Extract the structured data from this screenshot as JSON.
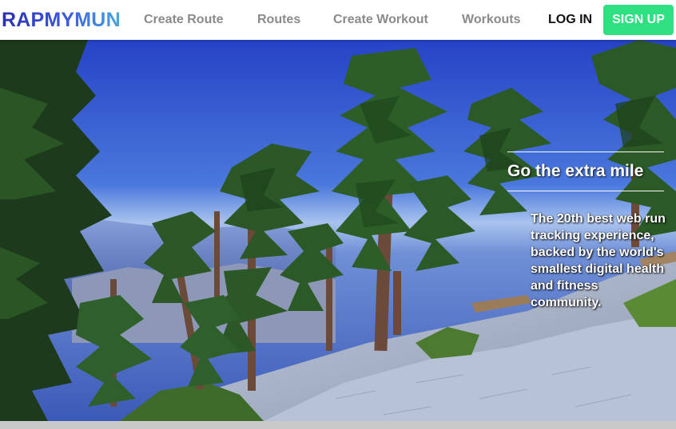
{
  "navbar": {
    "logo": "RAPMYMUN",
    "links": {
      "create_route": "Create Route",
      "routes": "Routes",
      "create_workout": "Create Workout",
      "workouts": "Workouts"
    },
    "login": "LOG IN",
    "signup": "SIGN UP"
  },
  "hero": {
    "image_icon": "hero-landscape-photo",
    "headline": "Go the extra mile",
    "subtext": "The 20th best web run tracking experience, backed by the world's smallest digital health and fitness community."
  },
  "colors": {
    "signup_bg": "#2ee07f",
    "nav_link": "#8a8a8a",
    "logo_gradient_start": "#2a2fb5",
    "logo_gradient_end": "#4aa6de",
    "sky_top": "#2a47c8",
    "sky_horizon": "#aac4ee"
  }
}
